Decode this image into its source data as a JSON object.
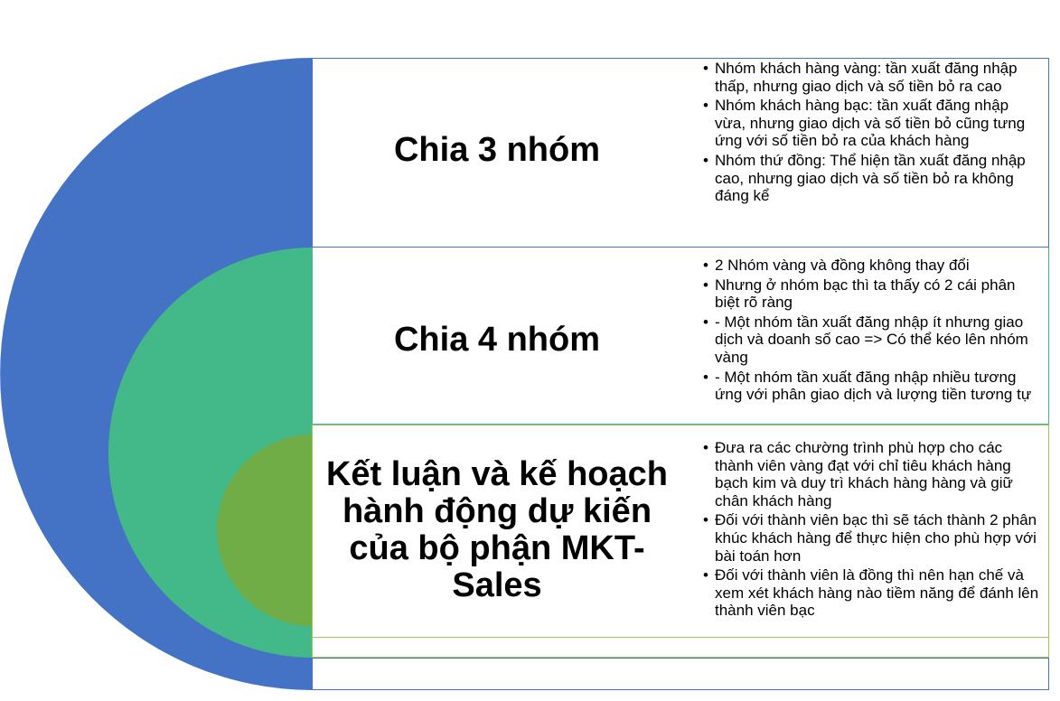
{
  "colors": {
    "outer_arc": "#4472c4",
    "middle_arc": "#43b98a",
    "inner_arc": "#70ad47",
    "panel_border_blue": "#4472c4",
    "panel_border_green": "#9fc85a"
  },
  "sections": [
    {
      "heading": "Chia 3 nhóm",
      "bullets": [
        "Nhóm khách hàng vàng: tần xuất đăng nhập thấp, nhưng giao dịch và số tiền bỏ ra cao",
        "Nhóm khách hàng bạc: tần xuất đăng nhập vừa, nhưng giao dịch và số tiền bỏ cũng tưng ứng với số tiền bỏ ra của khách hàng",
        "Nhóm thứ đồng: Thể hiện tần xuất đăng nhập cao, nhưng giao dịch và số tiền bỏ ra không đáng kể"
      ]
    },
    {
      "heading": "Chia 4 nhóm",
      "bullets": [
        "2 Nhóm vàng và đồng không thay đổi",
        "Nhưng ở nhóm bạc thì ta thấy có 2 cái phân biệt rõ ràng",
        "- Một nhóm tần xuất đăng nhập ít nhưng giao dịch và doanh số cao => Có thể kéo lên nhóm vàng",
        "- Một nhóm tần xuất đăng nhập nhiều tương ứng với phân giao dịch và lượng tiền tương tự"
      ]
    },
    {
      "heading": "Kết luận và kế hoạch hành động dự kiến của bộ phận MKT-Sales",
      "bullets": [
        "Đưa ra các chường trình phù hợp cho các thành viên vàng đạt với chỉ tiêu khách hàng bạch kim và duy trì khách hàng hàng và giữ chân khách hàng",
        "Đối với thành viên bạc thì sẽ tách thành 2 phân khúc khách hàng để thực hiện cho phù hợp với bài toán hơn",
        "Đối với thành viên là đồng thì nên hạn chế và xem xét khách hàng nào tiềm năng để đánh lên thành viên bạc"
      ]
    }
  ]
}
